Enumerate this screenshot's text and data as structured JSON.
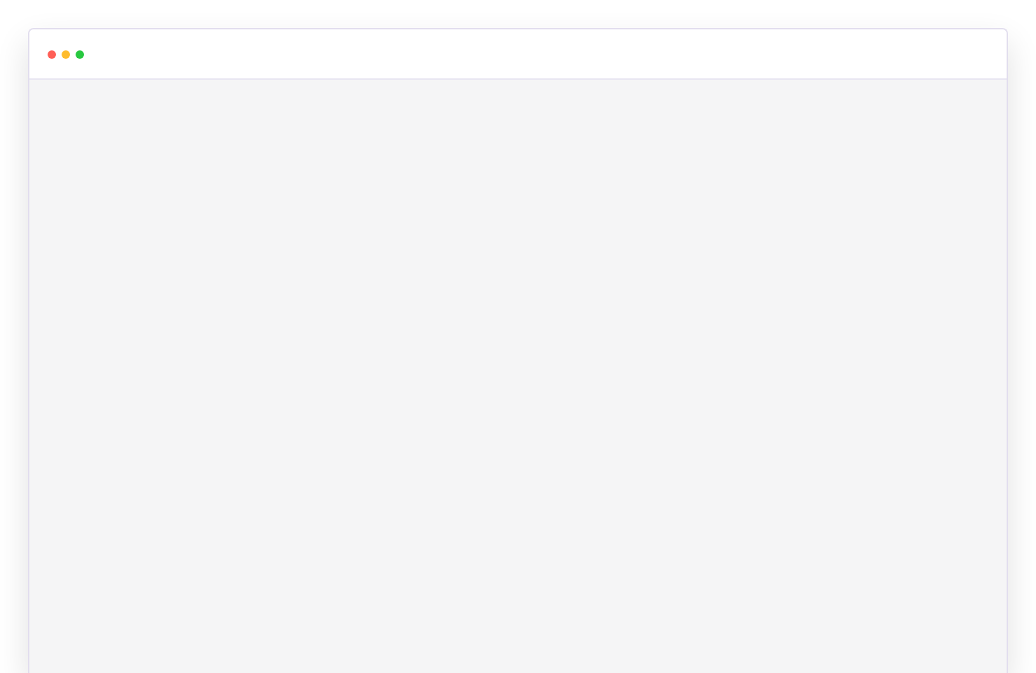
{
  "window": {
    "controls": [
      {
        "color": "#ff5f57"
      },
      {
        "color": "#febc2e"
      },
      {
        "color": "#28c840"
      }
    ]
  }
}
